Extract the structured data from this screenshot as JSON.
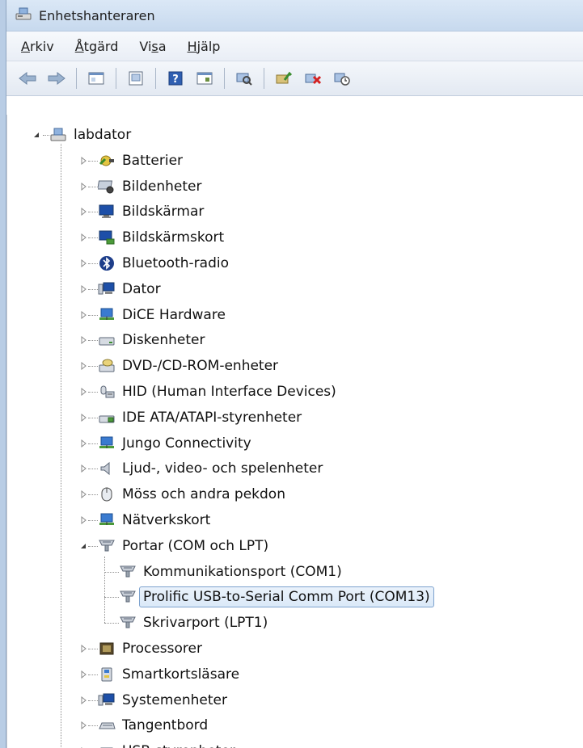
{
  "window": {
    "title": "Enhetshanteraren"
  },
  "menu": [
    {
      "pre": "",
      "ul": "A",
      "post": "rkiv"
    },
    {
      "pre": "",
      "ul": "Å",
      "post": "tgärd"
    },
    {
      "pre": "Vi",
      "ul": "s",
      "post": "a"
    },
    {
      "pre": "",
      "ul": "H",
      "post": "jälp"
    }
  ],
  "toolbar": [
    "back-icon",
    "forward-icon",
    "show-hide-tree-icon",
    "properties-icon",
    "help-icon",
    "view-icon",
    "scan-hardware-icon",
    "update-driver-icon",
    "uninstall-icon",
    "disable-device-icon"
  ],
  "root": {
    "label": "labdator"
  },
  "categories": [
    {
      "label": "Batterier",
      "icon": "battery-icon"
    },
    {
      "label": "Bildenheter",
      "icon": "camera-icon"
    },
    {
      "label": "Bildskärmar",
      "icon": "monitor-icon"
    },
    {
      "label": "Bildskärmskort",
      "icon": "display-adapter-icon"
    },
    {
      "label": "Bluetooth-radio",
      "icon": "bluetooth-icon"
    },
    {
      "label": "Dator",
      "icon": "computer-icon"
    },
    {
      "label": "DiCE Hardware",
      "icon": "network-device-icon"
    },
    {
      "label": "Diskenheter",
      "icon": "disk-drive-icon"
    },
    {
      "label": "DVD-/CD-ROM-enheter",
      "icon": "dvd-drive-icon"
    },
    {
      "label": "HID (Human Interface Devices)",
      "icon": "hid-icon"
    },
    {
      "label": "IDE ATA/ATAPI-styrenheter",
      "icon": "ide-controller-icon"
    },
    {
      "label": "Jungo Connectivity",
      "icon": "network-device-icon"
    },
    {
      "label": "Ljud-, video- och spelenheter",
      "icon": "speaker-icon"
    },
    {
      "label": "Möss och andra pekdon",
      "icon": "mouse-icon"
    },
    {
      "label": "Nätverkskort",
      "icon": "network-adapter-icon"
    },
    {
      "label": "Portar (COM och LPT)",
      "icon": "port-icon",
      "expanded": true,
      "children": [
        {
          "label": "Kommunikationsport (COM1)"
        },
        {
          "label": "Prolific USB-to-Serial Comm Port (COM13)",
          "selected": true
        },
        {
          "label": "Skrivarport (LPT1)"
        }
      ]
    },
    {
      "label": "Processorer",
      "icon": "processor-icon"
    },
    {
      "label": "Smartkortsläsare",
      "icon": "smartcard-reader-icon"
    },
    {
      "label": "Systemenheter",
      "icon": "system-device-icon"
    },
    {
      "label": "Tangentbord",
      "icon": "keyboard-icon"
    },
    {
      "label": "USB-styrenheter",
      "icon": "usb-icon"
    }
  ]
}
